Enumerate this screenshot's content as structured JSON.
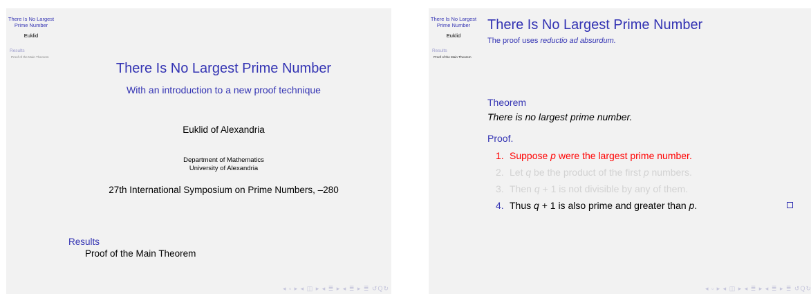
{
  "slide1": {
    "sidebar": {
      "title": "There Is No Largest Prime Number",
      "author": "Euklid",
      "section": "Results",
      "subsection": "Proof of the Main Theorem"
    },
    "title": "There Is No Largest Prime Number",
    "subtitle": "With an introduction to a new proof technique",
    "author": "Euklid of Alexandria",
    "institute_line1": "Department of Mathematics",
    "institute_line2": "University of Alexandria",
    "date": "27th International Symposium on Prime Numbers, –280",
    "toc_section": "Results",
    "toc_subsection": "Proof of the Main Theorem",
    "nav": "◂ ▫ ▸ ◂ ◫ ▸ ◂ ≣ ▸ ◂ ≣ ▸   ≣   ↺Q↻"
  },
  "slide2": {
    "sidebar": {
      "title": "There Is No Largest Prime Number",
      "author": "Euklid",
      "section": "Results",
      "subsection": "Proof of the Main Theorem"
    },
    "frame_title": "There Is No Largest Prime Number",
    "frame_subtitle_prefix": "The proof uses ",
    "frame_subtitle_emph": "reductio ad absurdum.",
    "theorem_head": "Theorem",
    "theorem_body": "There is no largest prime number.",
    "proof_head": "Proof.",
    "steps": [
      {
        "n": "1.",
        "parts": [
          "Suppose ",
          "p",
          " were the largest prime number."
        ]
      },
      {
        "n": "2.",
        "parts": [
          "Let ",
          "q",
          " be the product of the first ",
          "p",
          " numbers."
        ]
      },
      {
        "n": "3.",
        "parts": [
          "Then ",
          "q",
          " + 1 is not divisible by any of them."
        ]
      },
      {
        "n": "4.",
        "parts": [
          "Thus ",
          "q",
          " + 1 is also prime and greater than ",
          "p",
          "."
        ]
      }
    ],
    "qed_symbol": "qed-box",
    "nav": "◂ ▫ ▸ ◂ ◫ ▸ ◂ ≣ ▸ ◂ ≣ ▸   ≣   ↺Q↻"
  },
  "colors": {
    "structure": "#3333b3",
    "alert": "#ff0000",
    "faded": "#d2d2d2",
    "slide_bg": "#f2f2f2"
  }
}
